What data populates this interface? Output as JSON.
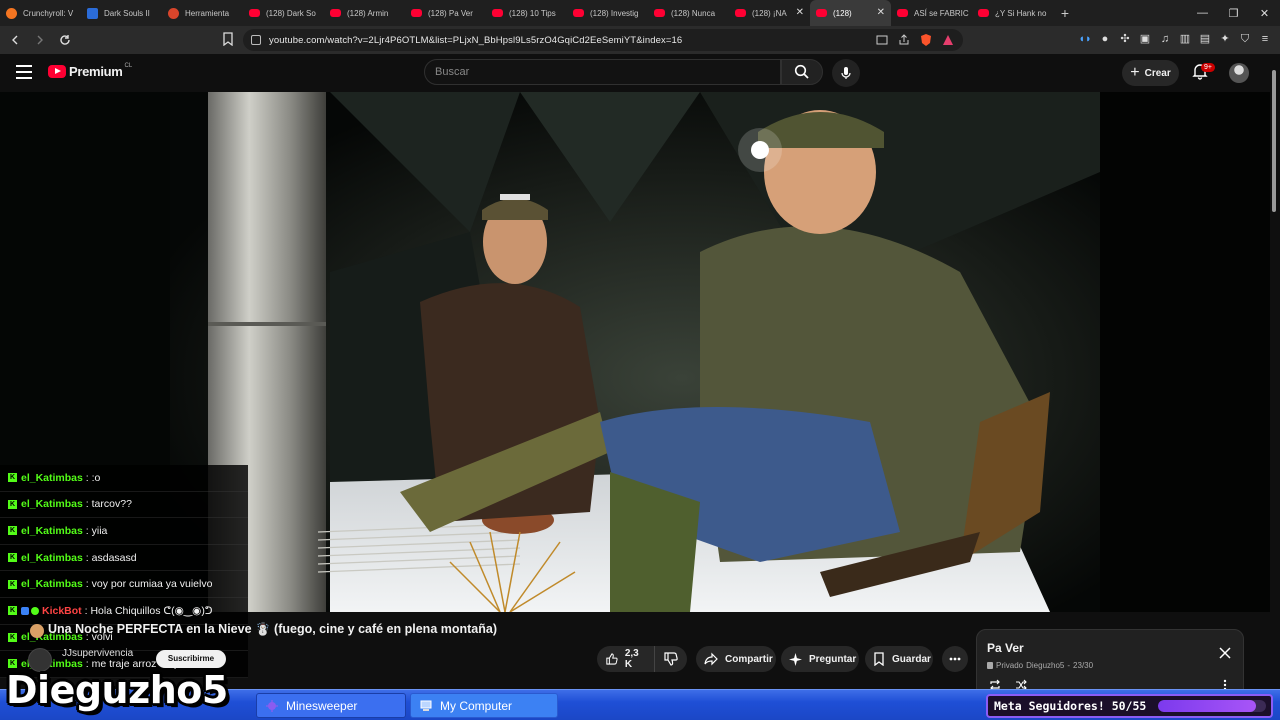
{
  "browser": {
    "tabs": [
      {
        "label": "Crunchyroll: V",
        "icon": "crunchyroll-icon"
      },
      {
        "label": "Dark Souls II",
        "icon": "edge-icon"
      },
      {
        "label": "Herramienta",
        "icon": "tool-icon"
      },
      {
        "label": "(128) Dark So",
        "icon": "youtube-icon"
      },
      {
        "label": "(128) Armin",
        "icon": "youtube-icon"
      },
      {
        "label": "(128) Pa Ver",
        "icon": "youtube-icon"
      },
      {
        "label": "(128) 10 Tips",
        "icon": "youtube-icon"
      },
      {
        "label": "(128) Investig",
        "icon": "youtube-icon"
      },
      {
        "label": "(128) Nunca",
        "icon": "youtube-icon"
      },
      {
        "label": "(128) ¡NA",
        "icon": "youtube-icon"
      },
      {
        "label": "(128)",
        "icon": "youtube-icon",
        "active": true
      },
      {
        "label": "ASÍ se FABRIC",
        "icon": "youtube-icon"
      },
      {
        "label": "¿Y Si Hank no",
        "icon": "youtube-icon"
      }
    ],
    "new_tab": "+",
    "url": "youtube.com/watch?v=2Ljr4P6OTLM&list=PLjxN_BbHpsl9Ls5rzO4GqiCd2EeSemiYT&index=16"
  },
  "youtube": {
    "logo_text": "Premium",
    "region": "CL",
    "search_placeholder": "Buscar",
    "create_label": "Crear",
    "notifications": "9+"
  },
  "chat": [
    {
      "user": "el_Katimbas",
      "message": ":o"
    },
    {
      "user": "el_Katimbas",
      "message": "tarcov??"
    },
    {
      "user": "el_Katimbas",
      "message": "yiia"
    },
    {
      "user": "el_Katimbas",
      "message": "asdasasd"
    },
    {
      "user": "el_Katimbas",
      "message": "voy por cumiaa ya vuielvo"
    },
    {
      "user": "KickBot",
      "message": "Hola Chiquillos ᕦ(◉‿◉)ᕤ",
      "bot": true
    },
    {
      "user": "el_Katimbas",
      "message": "volvi"
    },
    {
      "user": "el_Katimbas",
      "message": "me traje arroz en pollo"
    }
  ],
  "video": {
    "title": "Una Noche PERFECTA en la Nieve ☃️ (fuego, cine y café en plena montaña)",
    "channel": "JJsupervivencia",
    "subscribe": "Suscribirme",
    "likes": "2,3 K",
    "share": "Compartir",
    "ask": "Preguntar",
    "save": "Guardar"
  },
  "playlist": {
    "title": "Pa Ver",
    "privacy": "Privado",
    "owner": "Dieguzho5",
    "position": "23/30"
  },
  "stream_overlay": {
    "streamer": "Dieguzho5",
    "goal_label": "Meta Seguidores! 50/55",
    "goal_progress": 0.909
  },
  "taskbar": {
    "items": [
      {
        "label": "Minesweeper"
      },
      {
        "label": "My Computer"
      }
    ]
  },
  "colors": {
    "youtube_red": "#ff0033",
    "kick_green": "#53fc18",
    "goal_purple": "#8b5cf6",
    "xp_taskbar": "#245edb"
  }
}
